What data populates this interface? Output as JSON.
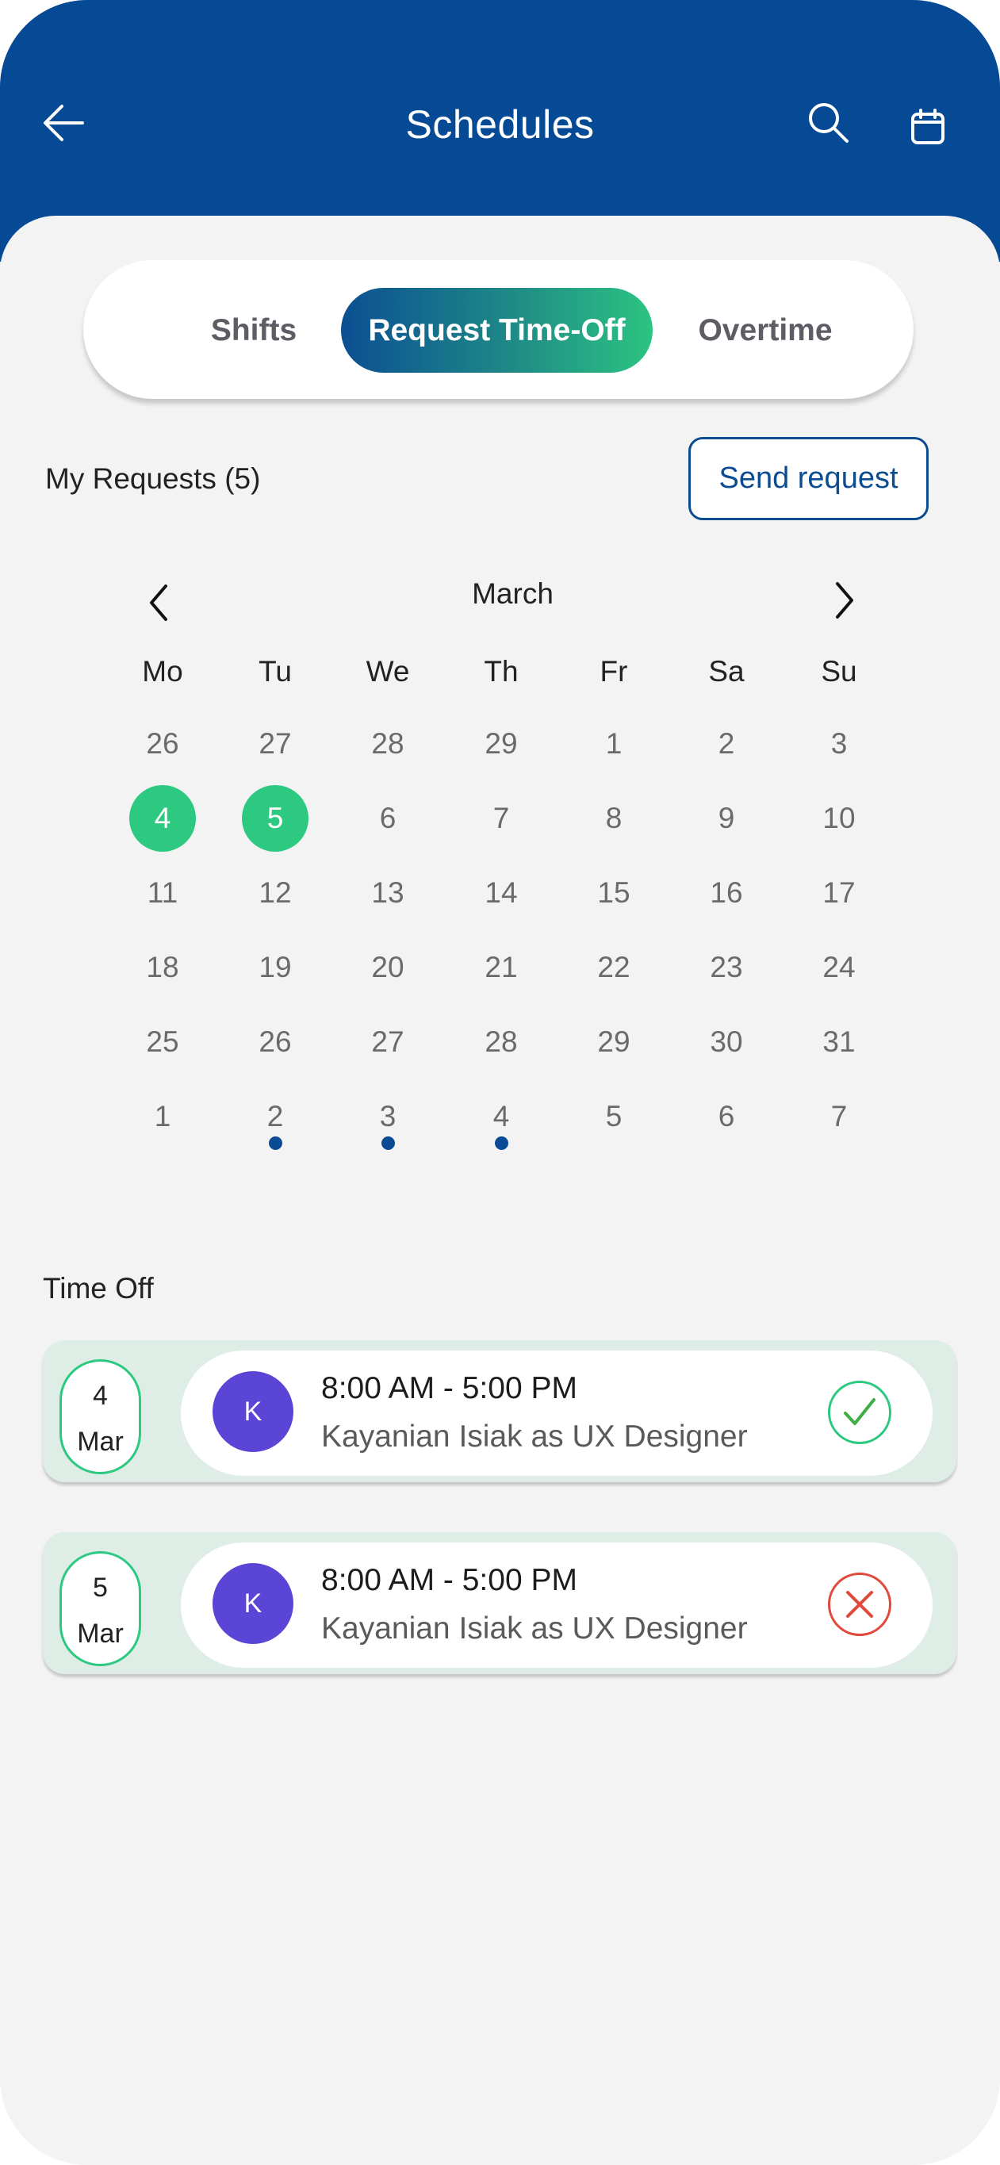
{
  "header": {
    "title": "Schedules",
    "back_icon": "arrow-left-icon",
    "search_icon": "search-icon",
    "calendar_icon": "calendar-icon"
  },
  "tabs": {
    "shifts": "Shifts",
    "request_time_off": "Request Time-Off",
    "overtime": "Overtime",
    "active": "request_time_off"
  },
  "requests": {
    "title": "My Requests (5)",
    "send_button": "Send request"
  },
  "calendar": {
    "month": "March",
    "weekdays": [
      "Mo",
      "Tu",
      "We",
      "Th",
      "Fr",
      "Sa",
      "Su"
    ],
    "weeks": [
      [
        "26",
        "27",
        "28",
        "29",
        "1",
        "2",
        "3"
      ],
      [
        "4",
        "5",
        "6",
        "7",
        "8",
        "9",
        "10"
      ],
      [
        "11",
        "12",
        "13",
        "14",
        "15",
        "16",
        "17"
      ],
      [
        "18",
        "19",
        "20",
        "21",
        "22",
        "23",
        "24"
      ],
      [
        "25",
        "26",
        "27",
        "28",
        "29",
        "30",
        "31"
      ],
      [
        "1",
        "2",
        "3",
        "4",
        "5",
        "6",
        "7"
      ]
    ],
    "selected_days": [
      "4",
      "5"
    ],
    "marked_days": [
      "2",
      "3",
      "4"
    ],
    "selected_color": "#2ec981",
    "marker_color": "#0b4a94"
  },
  "time_off": {
    "title": "Time Off",
    "entries": [
      {
        "day": "4",
        "month": "Mar",
        "avatar": "K",
        "time": "8:00 AM - 5:00 PM",
        "person": "Kayanian Isiak as UX Designer",
        "status": "approved",
        "status_icon": "check-icon"
      },
      {
        "day": "5",
        "month": "Mar",
        "avatar": "K",
        "time": "8:00 AM - 5:00 PM",
        "person": "Kayanian Isiak as UX Designer",
        "status": "rejected",
        "status_icon": "close-icon"
      }
    ]
  },
  "colors": {
    "header": "#064a96",
    "accent": "#2ec981",
    "avatar": "#5b45d6",
    "reject": "#e0493b"
  }
}
